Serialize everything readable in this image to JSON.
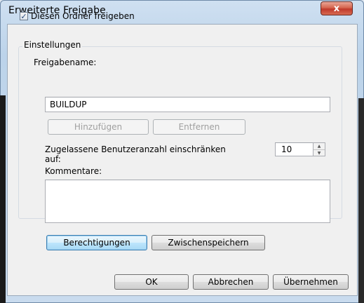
{
  "window": {
    "title": "Erweiterte Freigabe",
    "close_label": "x"
  },
  "share_checkbox": {
    "label": "Diesen Ordner freigeben",
    "checked": true,
    "check_glyph": "✓"
  },
  "settings": {
    "group_label": "Einstellungen",
    "share_name_label": "Freigabename:",
    "share_name_value": "BUILDUP",
    "add_button": "Hinzufügen",
    "remove_button": "Entfernen",
    "limit_label_line1": "Zugelassene Benutzeranzahl einschränken",
    "limit_label_line2": "auf:",
    "limit_value": "10",
    "comments_label": "Kommentare:",
    "comments_value": "",
    "permissions_button": "Berechtigungen",
    "caching_button": "Zwischenspeichern"
  },
  "footer": {
    "ok": "OK",
    "cancel": "Abbrechen",
    "apply": "Übernehmen"
  },
  "icons": {
    "close": "close-icon",
    "spin_up": "▲",
    "spin_down": "▼"
  }
}
